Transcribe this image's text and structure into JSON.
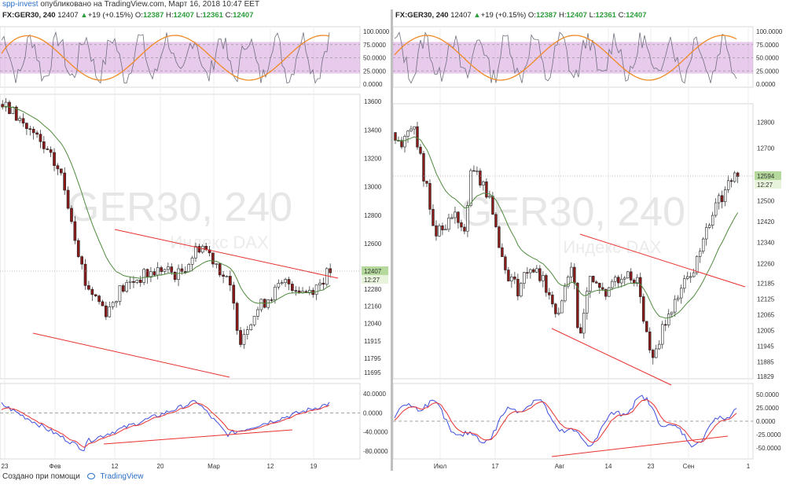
{
  "header": {
    "author": "spp-invest",
    "published": "опубликовано на TradingView.com, Март 16, 2018 10:47 EET"
  },
  "footer": {
    "created_by": "Создано при помощи",
    "brand": "TradingView"
  },
  "colors": {
    "up": "#ffffff",
    "down": "#8b1a1a",
    "ma": "#4f8a3c",
    "trend": "#e8312f",
    "stoch_k": "#6f6f7f",
    "stoch_d": "#f08a24",
    "band": "#d9a6e0",
    "macd": "#3e4de0",
    "signal": "#e8312f",
    "price_tag": "#b5d99c"
  },
  "chart_data": [
    {
      "type": "candlestick",
      "symbol_line": {
        "symbol": "FX:GER30, 240",
        "last": "12407",
        "change": "+19 (+0.15%)",
        "o_label": "O:",
        "o": "12387",
        "h_label": "H:",
        "h": "12407",
        "l_label": "L:",
        "l": "12361",
        "c_label": "C:",
        "c": "12407"
      },
      "watermark": "GER30, 240",
      "watermark_sub": "Индекс DAX",
      "x_tick_labels": [
        "23",
        "Фев",
        "12",
        "20",
        "Мар",
        "12",
        "19"
      ],
      "price_ticks": [
        "13600",
        "13400",
        "13200",
        "13000",
        "12800",
        "12600",
        "12400",
        "12280",
        "12160",
        "12040",
        "11915",
        "11795",
        "11695"
      ],
      "price_range": [
        11650,
        13650
      ],
      "last_price_tag": "12407",
      "time_tag": "12:27",
      "stoch_ticks": [
        "100.0000",
        "75.0000",
        "50.0000",
        "25.0000",
        "0.0000"
      ],
      "macd_ticks": [
        "40.0000",
        "0.0000",
        "-40.0000",
        "-80.0000"
      ]
    },
    {
      "type": "candlestick",
      "symbol_line": {
        "symbol": "FX:GER30, 240",
        "last": "12407",
        "change": "+19 (+0.15%)",
        "o_label": "O:",
        "o": "12387",
        "h_label": "H:",
        "h": "12407",
        "l_label": "L:",
        "l": "12361",
        "c_label": "C:",
        "c": "12407"
      },
      "watermark": "GER30, 240",
      "watermark_sub": "Индекс DAX",
      "x_tick_labels": [
        "Июл",
        "17",
        "Авг",
        "14",
        "23",
        "Сен",
        "1"
      ],
      "price_ticks": [
        "12800",
        "12700",
        "12594",
        "12500",
        "12420",
        "12340",
        "12260",
        "12185",
        "12125",
        "12065",
        "12005",
        "11945",
        "11885",
        "11829"
      ],
      "price_range": [
        11820,
        12870
      ],
      "last_price_tag": "12594",
      "time_tag": "12:27",
      "stoch_ticks": [
        "100.0000",
        "75.0000",
        "50.0000",
        "25.0000",
        "0.0000"
      ],
      "macd_ticks": [
        "50.0000",
        "25.0000",
        "0.0000",
        "-25.0000",
        "-50.0000"
      ]
    }
  ]
}
